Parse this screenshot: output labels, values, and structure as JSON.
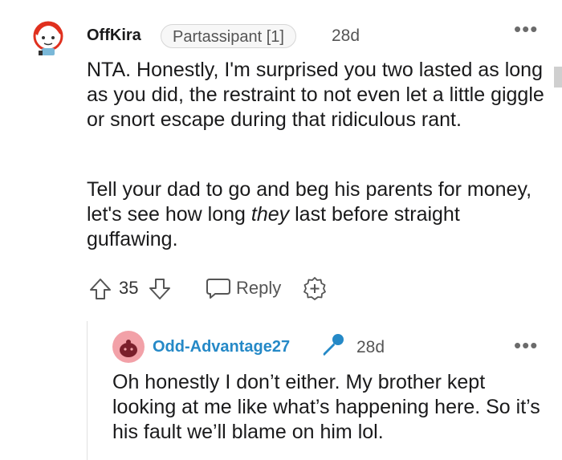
{
  "comment": {
    "username": "OffKira",
    "flair": "Partassipant [1]",
    "time": "28d",
    "more": "•••",
    "paragraph1": "NTA. Honestly, I'm surprised you two lasted as long as you did, the restraint to not even let a little giggle or snort escape during that ridiculous rant.",
    "paragraph2_before": "Tell your dad to go and beg his parents for money, let's see how long ",
    "paragraph2_emph": "they",
    "paragraph2_after": " last before straight guffawing.",
    "votes": "35",
    "reply_label": "Reply"
  },
  "reply": {
    "username": "Odd-Advantage27",
    "time": "28d",
    "more": "•••",
    "text": "Oh honestly I don’t either. My brother kept looking at me like what’s happening here. So it’s his fault we’ll blame on him lol."
  },
  "colors": {
    "reply_username": "#2589c7",
    "mic_icon": "#2589c7",
    "avatar2_bg": "#f2a1a8"
  },
  "icons": [
    "avatar-image",
    "upvote-icon",
    "downvote-icon",
    "reply-bubble-icon",
    "award-plus-icon",
    "microphone-icon",
    "more-options-icon"
  ]
}
